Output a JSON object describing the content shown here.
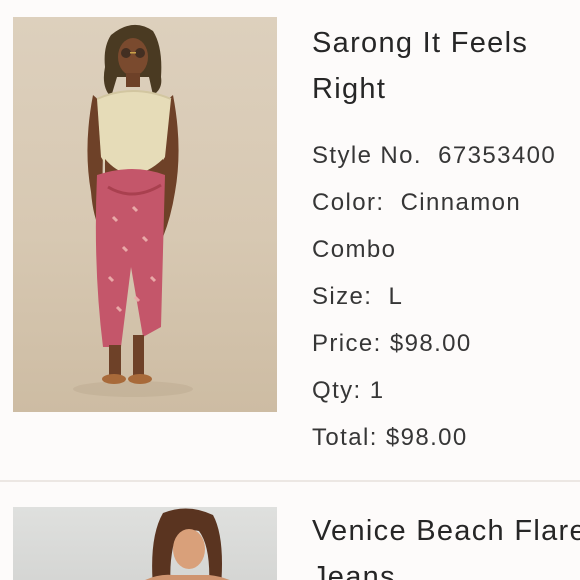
{
  "products": [
    {
      "title_line1": "Sarong It Feels",
      "title_line2": "Right",
      "style_label": "Style No.",
      "style_value": "67353400",
      "color_label": "Color:",
      "color_value_line1": "Cinnamon",
      "color_value_line2": "Combo",
      "size_label": "Size:",
      "size_value": "L",
      "price_label": "Price:",
      "price_value": "$98.00",
      "qty_label": "Qty:",
      "qty_value": "1",
      "total_label": "Total:",
      "total_value": "$98.00"
    },
    {
      "title_line1": "Venice Beach Flare",
      "title_line2": "Jeans"
    }
  ],
  "colors": {
    "background": "#fdfbfa",
    "divider": "#ece7e3",
    "text": "#2b2b2b",
    "skirt": "#c4566a",
    "top": "#e6dcb8"
  }
}
